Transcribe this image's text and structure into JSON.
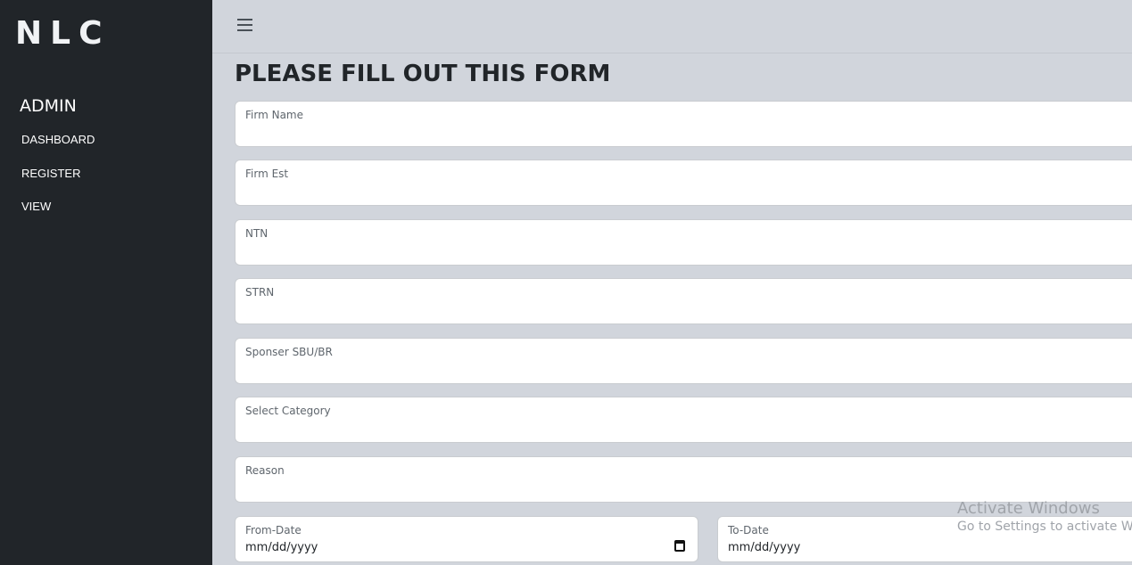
{
  "sidebar": {
    "logo": "NLC",
    "role": "ADMIN",
    "items": [
      {
        "label": "DASHBOARD"
      },
      {
        "label": "REGISTER"
      },
      {
        "label": "VIEW"
      }
    ]
  },
  "topbar": {
    "menu_icon": "hamburger-icon"
  },
  "form": {
    "title": "PLEASE FILL OUT THIS FORM",
    "fields": [
      {
        "label": "Firm Name",
        "value": ""
      },
      {
        "label": "Firm Est",
        "value": ""
      },
      {
        "label": "NTN",
        "value": ""
      },
      {
        "label": "STRN",
        "value": ""
      },
      {
        "label": "Sponser SBU/BR",
        "value": ""
      },
      {
        "label": "Select Category",
        "value": ""
      },
      {
        "label": "Reason",
        "value": ""
      }
    ],
    "from_date": {
      "label": "From-Date",
      "value": "mm/dd/yyyy",
      "icon": "calendar-icon"
    },
    "to_date": {
      "label": "To-Date",
      "value": "mm/dd/yyyy"
    }
  },
  "watermark": {
    "title": "Activate Windows",
    "subtitle": "Go to Settings to activate Windows."
  }
}
